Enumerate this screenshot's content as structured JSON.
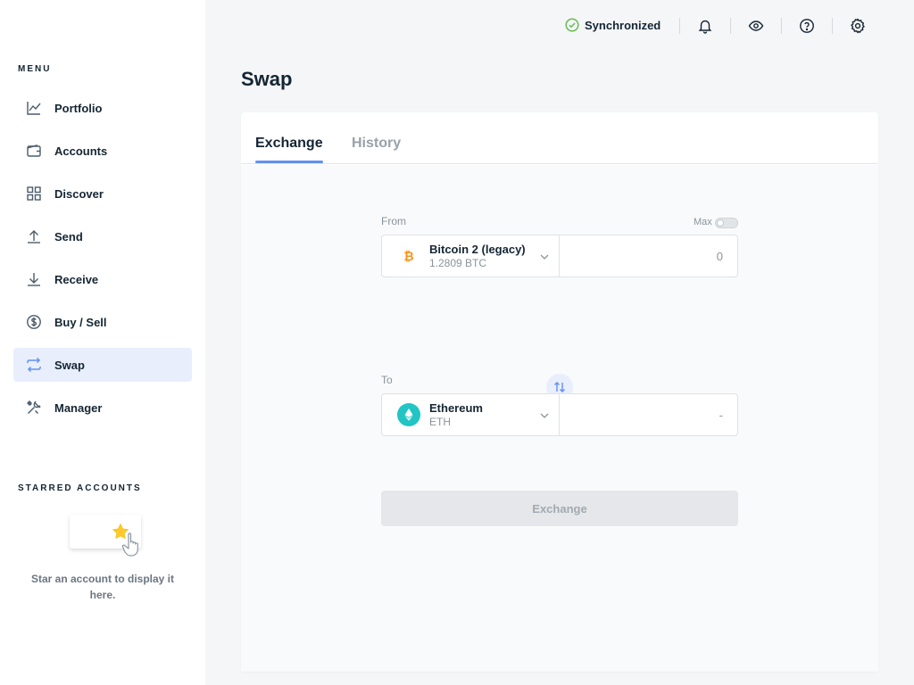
{
  "sidebar": {
    "menu_title": "MENU",
    "items": [
      {
        "label": "Portfolio",
        "icon": "chart-icon"
      },
      {
        "label": "Accounts",
        "icon": "wallet-icon"
      },
      {
        "label": "Discover",
        "icon": "grid-icon"
      },
      {
        "label": "Send",
        "icon": "arrow-up-icon"
      },
      {
        "label": "Receive",
        "icon": "arrow-down-icon"
      },
      {
        "label": "Buy / Sell",
        "icon": "dollar-icon"
      },
      {
        "label": "Swap",
        "icon": "swap-icon",
        "active": true
      },
      {
        "label": "Manager",
        "icon": "tools-icon"
      }
    ],
    "starred_title": "STARRED ACCOUNTS",
    "starred_empty": "Star an account to display it here."
  },
  "topbar": {
    "sync_status": "Synchronized",
    "buttons": [
      "bell-icon",
      "eye-icon",
      "help-icon",
      "settings-icon"
    ]
  },
  "page": {
    "title": "Swap"
  },
  "tabs": [
    {
      "label": "Exchange",
      "active": true
    },
    {
      "label": "History",
      "active": false
    }
  ],
  "from": {
    "label": "From",
    "max_label": "Max",
    "max_enabled": false,
    "account_name": "Bitcoin 2 (legacy)",
    "balance": "1.2809 BTC",
    "amount_placeholder": "0"
  },
  "to": {
    "label": "To",
    "currency_name": "Ethereum",
    "ticker": "ETH",
    "amount_placeholder": "-"
  },
  "exchange_button": "Exchange",
  "colors": {
    "accent": "#6490f1",
    "sync_green": "#66be54",
    "btc_orange": "#f7931a",
    "eth_teal": "#21c5c3"
  }
}
